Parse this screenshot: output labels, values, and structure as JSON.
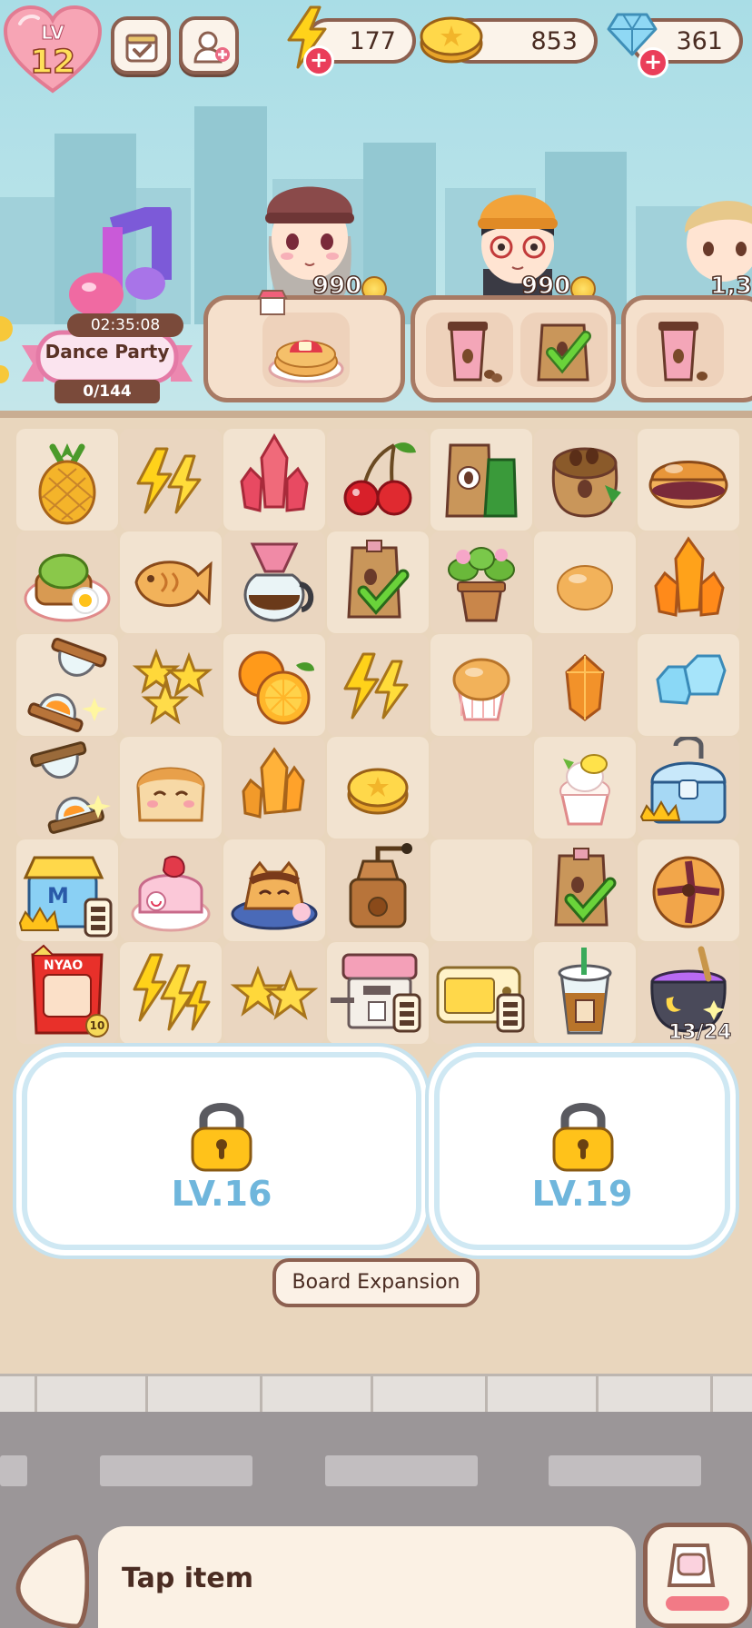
{
  "player": {
    "level_label": "LV",
    "level": "12"
  },
  "resources": {
    "energy": "177",
    "coins": "853",
    "gems": "361"
  },
  "customers": [
    {
      "reward": "990"
    },
    {
      "reward": "990"
    },
    {
      "reward": "1,3"
    }
  ],
  "event": {
    "time_left": "02:35:08",
    "name": "Dance Party",
    "progress": "0/144"
  },
  "board": {
    "columns": 7,
    "rows": 6,
    "cells": [
      "pineapple",
      "lightning-2",
      "red-crystal",
      "cherries",
      "coffee-bags",
      "coffee-sack",
      "dorayaki",
      "avocado-toast",
      "taiyaki",
      "coffee-pot",
      "coffee-bag-check",
      "flower-pot",
      "bun",
      "orange-crystal",
      "hourglass",
      "stars-3",
      "oranges",
      "lightning-2",
      "muffin",
      "amber-gem",
      "blue-gems",
      "hourglass-2",
      "bread-cat",
      "amber-crystal",
      "coin",
      "",
      "lemon-cupcake",
      "blue-chest",
      "blue-shop",
      "strawberry-roll",
      "cat-pudding",
      "coffee-grinder",
      "",
      "coffee-bag-check",
      "cookie",
      "nyao-snack-pack",
      "lightning-3",
      "stars-2",
      "espresso-machine",
      "toaster",
      "iced-coffee",
      "cauldron"
    ],
    "badges": {
      "cauldron_count": "13/24",
      "snack_count": "10"
    }
  },
  "locked_areas": [
    {
      "label": "LV.16"
    },
    {
      "label": "LV.19"
    }
  ],
  "expand_button": "Board Expansion",
  "footer": {
    "hint": "Tap item"
  },
  "colors": {
    "accent_pink": "#ea3e5a",
    "frame_brown": "#8c6050",
    "lock_blue": "#6fb6dc"
  }
}
